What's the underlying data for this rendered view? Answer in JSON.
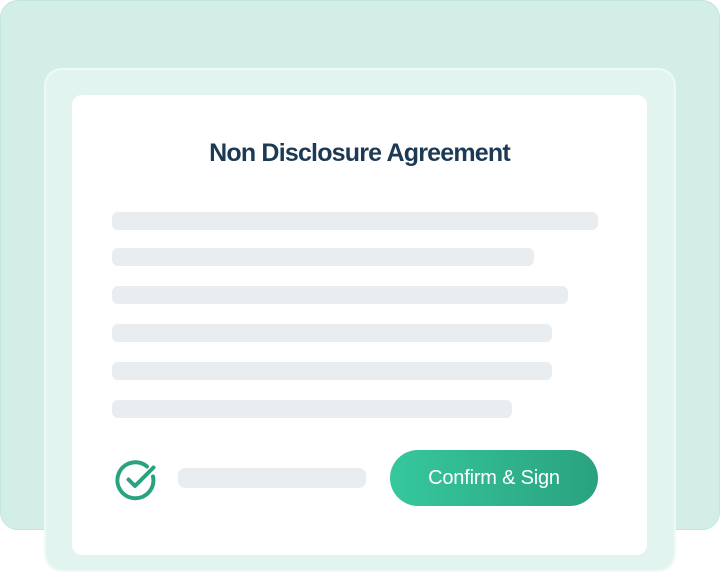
{
  "document": {
    "title": "Non Disclosure Agreement"
  },
  "actions": {
    "confirm_label": "Confirm & Sign"
  },
  "colors": {
    "accent": "#2aa27f",
    "accent_light": "#36c79d",
    "background": "#d3eee6",
    "title": "#1d3a54",
    "skeleton": "#eaedf0"
  },
  "icons": {
    "agreement_check": "check-circle-icon"
  }
}
